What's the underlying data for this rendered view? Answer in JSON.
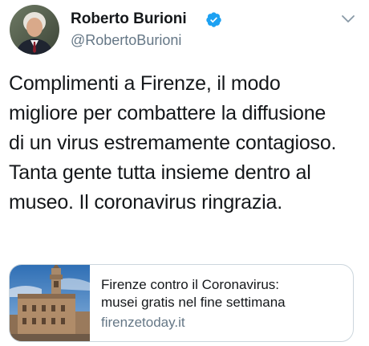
{
  "author": {
    "name": "Roberto Burioni",
    "handle": "@RobertoBurioni",
    "verified_icon": "verified-badge-icon",
    "avatar_icon": "user-avatar",
    "verified_color": "#1da1f2"
  },
  "menu": {
    "icon": "chevron-down-icon"
  },
  "tweet": {
    "lines": [
      "Complimenti a Firenze, il modo",
      "migliore per combattere la diffusione",
      "di un virus estremamente contagioso.",
      "Tanta gente tutta insieme dentro al",
      "museo. Il coronavirus ringrazia."
    ]
  },
  "card": {
    "title_lines": [
      "Firenze contro il Coronavirus:",
      "musei gratis nel fine settimana"
    ],
    "domain": "firenzetoday.it",
    "thumbnail": "palazzo-vecchio-photo"
  },
  "colors": {
    "text": "#14171a",
    "secondary": "#657786",
    "border": "#ccd6dd"
  }
}
